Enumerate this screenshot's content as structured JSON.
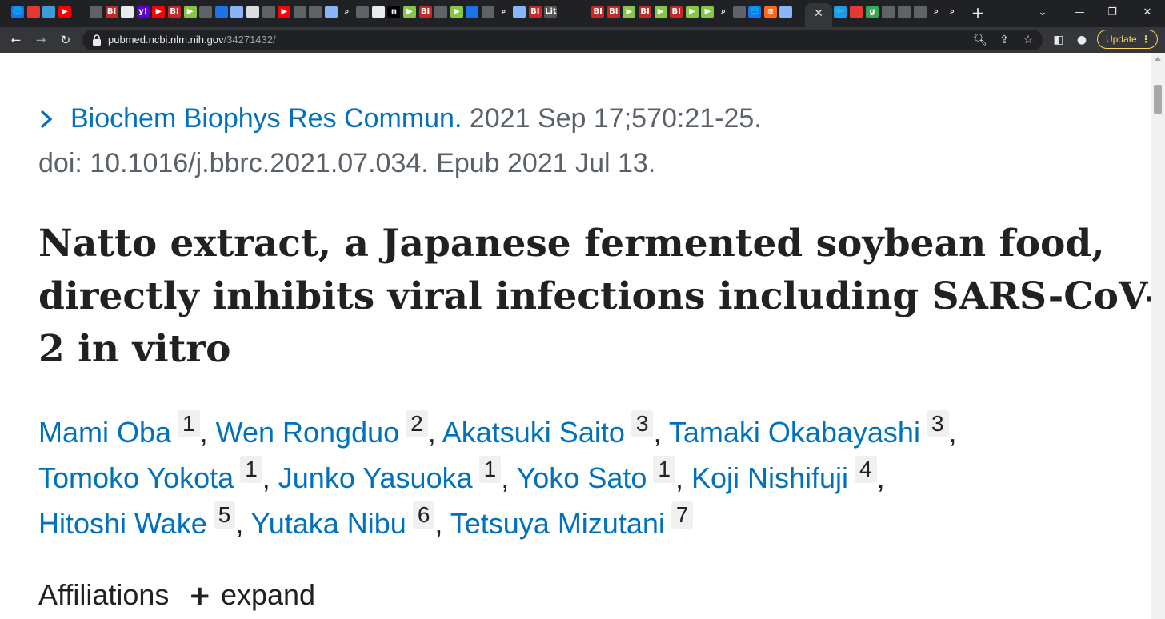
{
  "browser": {
    "new_tab_symbol": "+",
    "active_tab_close": "✕",
    "window_controls": {
      "dropdown": "⌄",
      "minimize": "—",
      "maximize": "❐",
      "close": "✕"
    },
    "tabs_favicons": [
      {
        "icon": "globe-icon",
        "label": "🌐",
        "color": "#1a73e8"
      },
      {
        "icon": "red-circle-icon",
        "label": "",
        "color": "#e53935"
      },
      {
        "icon": "generic-icon",
        "label": "",
        "color": "#3c9cd8"
      },
      {
        "icon": "youtube-icon",
        "label": "▶",
        "color": "#ff0000"
      },
      {
        "icon": "blank-icon",
        "label": "",
        "color": "#202124"
      },
      {
        "icon": "gray-circle-icon",
        "label": "",
        "color": "#5f6368"
      },
      {
        "icon": "business-insider-icon",
        "label": "BI",
        "color": "#c62828"
      },
      {
        "icon": "reuters-icon",
        "label": "",
        "color": "#e8eaed"
      },
      {
        "icon": "yahoo-icon",
        "label": "y!",
        "color": "#6001d2"
      },
      {
        "icon": "youtube-icon",
        "label": "▶",
        "color": "#ff0000"
      },
      {
        "icon": "business-insider-icon",
        "label": "BI",
        "color": "#c62828"
      },
      {
        "icon": "rumble-icon",
        "label": "▶",
        "color": "#85c742"
      },
      {
        "icon": "gray-circle-icon",
        "label": "",
        "color": "#5f6368"
      },
      {
        "icon": "shield-icon",
        "label": "",
        "color": "#1a73e8"
      },
      {
        "icon": "document-icon",
        "label": "",
        "color": "#8ab4f8"
      },
      {
        "icon": "grid-icon",
        "label": "",
        "color": "#dadce0"
      },
      {
        "icon": "gray-circle-icon",
        "label": "",
        "color": "#5f6368"
      },
      {
        "icon": "youtube-icon",
        "label": "▶",
        "color": "#ff0000"
      },
      {
        "icon": "gray-circle-icon",
        "label": "",
        "color": "#5f6368"
      },
      {
        "icon": "gray-circle-icon",
        "label": "",
        "color": "#5f6368"
      },
      {
        "icon": "document-icon",
        "label": "",
        "color": "#8ab4f8"
      },
      {
        "icon": "search-icon",
        "label": "⌕",
        "color": "#202124"
      },
      {
        "icon": "gray-circle-icon",
        "label": "",
        "color": "#5f6368"
      },
      {
        "icon": "reuters-icon",
        "label": "",
        "color": "#e8eaed"
      },
      {
        "icon": "n-icon",
        "label": "n",
        "color": "#000000"
      },
      {
        "icon": "rumble-icon",
        "label": "▶",
        "color": "#85c742"
      },
      {
        "icon": "business-insider-icon",
        "label": "BI",
        "color": "#c62828"
      },
      {
        "icon": "gray-circle-icon",
        "label": "",
        "color": "#5f6368"
      },
      {
        "icon": "rumble-icon",
        "label": "▶",
        "color": "#85c742"
      },
      {
        "icon": "shield-icon",
        "label": "",
        "color": "#1a73e8"
      },
      {
        "icon": "gray-circle-icon",
        "label": "",
        "color": "#5f6368"
      },
      {
        "icon": "search-icon",
        "label": "⌕",
        "color": "#202124"
      },
      {
        "icon": "document-icon",
        "label": "",
        "color": "#8ab4f8"
      },
      {
        "icon": "business-insider-icon",
        "label": "BI",
        "color": "#c62828"
      },
      {
        "icon": "lit-icon",
        "label": "Lit",
        "color": "#555555"
      },
      {
        "icon": "blank-icon",
        "label": "",
        "color": "#202124"
      },
      {
        "icon": "blank-icon",
        "label": "",
        "color": "#202124"
      },
      {
        "icon": "business-insider-icon",
        "label": "BI",
        "color": "#c62828"
      },
      {
        "icon": "business-insider-icon",
        "label": "BI",
        "color": "#c62828"
      },
      {
        "icon": "rumble-icon",
        "label": "▶",
        "color": "#85c742"
      },
      {
        "icon": "business-insider-icon",
        "label": "BI",
        "color": "#c62828"
      },
      {
        "icon": "rumble-icon",
        "label": "▶",
        "color": "#85c742"
      },
      {
        "icon": "business-insider-icon",
        "label": "BI",
        "color": "#c62828"
      },
      {
        "icon": "rumble-icon",
        "label": "▶",
        "color": "#85c742"
      },
      {
        "icon": "rumble-icon",
        "label": "▶",
        "color": "#85c742"
      },
      {
        "icon": "search-icon",
        "label": "⌕",
        "color": "#202124"
      },
      {
        "icon": "gray-circle-icon",
        "label": "",
        "color": "#5f6368"
      },
      {
        "icon": "globe-icon",
        "label": "🌐",
        "color": "#1a73e8"
      },
      {
        "icon": "substack-icon",
        "label": "≡",
        "color": "#ff6719"
      },
      {
        "icon": "document-icon",
        "label": "",
        "color": "#8ab4f8"
      }
    ],
    "tabs_after_active": [
      {
        "icon": "twitter-icon",
        "label": "🐦",
        "color": "#1d9bf0"
      },
      {
        "icon": "red-icon",
        "label": "",
        "color": "#e53935"
      },
      {
        "icon": "g-icon",
        "label": "g",
        "color": "#34a853"
      },
      {
        "icon": "gray-circle-icon",
        "label": "",
        "color": "#5f6368"
      },
      {
        "icon": "gray-circle-icon",
        "label": "",
        "color": "#5f6368"
      },
      {
        "icon": "gray-circle-icon",
        "label": "",
        "color": "#5f6368"
      },
      {
        "icon": "search-icon",
        "label": "⌕",
        "color": "#202124"
      },
      {
        "icon": "search-icon",
        "label": "⌕",
        "color": "#202124"
      }
    ],
    "url_host": "pubmed.ncbi.nlm.nih.gov",
    "url_path": "/34271432/",
    "update_label": "Update",
    "update_dots": "⋮",
    "colors": {
      "tab_bg": "#202124",
      "toolbar_bg": "#35363a",
      "update": "#fdd663"
    }
  },
  "article": {
    "citation": {
      "journal": "Biochem Biophys Res Commun.",
      "date_pages": " 2021 Sep 17;570:21-25.",
      "doi_line": "doi: 10.1016/j.bbrc.2021.07.034. Epub 2021 Jul 13."
    },
    "title_lines": [
      "Natto extract, a Japanese fermented soybean food,",
      "directly inhibits viral infections including SARS-CoV-",
      "2 in vitro"
    ],
    "authors": [
      {
        "name": "Mami Oba",
        "aff": "1"
      },
      {
        "name": "Wen Rongduo",
        "aff": "2"
      },
      {
        "name": "Akatsuki Saito",
        "aff": "3"
      },
      {
        "name": "Tamaki Okabayashi",
        "aff": "3"
      },
      {
        "name": "Tomoko Yokota",
        "aff": "1"
      },
      {
        "name": "Junko Yasuoka",
        "aff": "1"
      },
      {
        "name": "Yoko Sato",
        "aff": "1"
      },
      {
        "name": "Koji Nishifuji",
        "aff": "4"
      },
      {
        "name": "Hitoshi Wake",
        "aff": "5"
      },
      {
        "name": "Yutaka Nibu",
        "aff": "6"
      },
      {
        "name": "Tetsuya Mizutani",
        "aff": "7"
      }
    ],
    "author_separator": ", ",
    "trailing_comma": ",",
    "affiliations": {
      "label": "Affiliations",
      "toggle": "+",
      "expand_label": "expand"
    },
    "colors": {
      "link": "#0071bc",
      "text": "#212121",
      "muted": "#5b616b"
    }
  }
}
